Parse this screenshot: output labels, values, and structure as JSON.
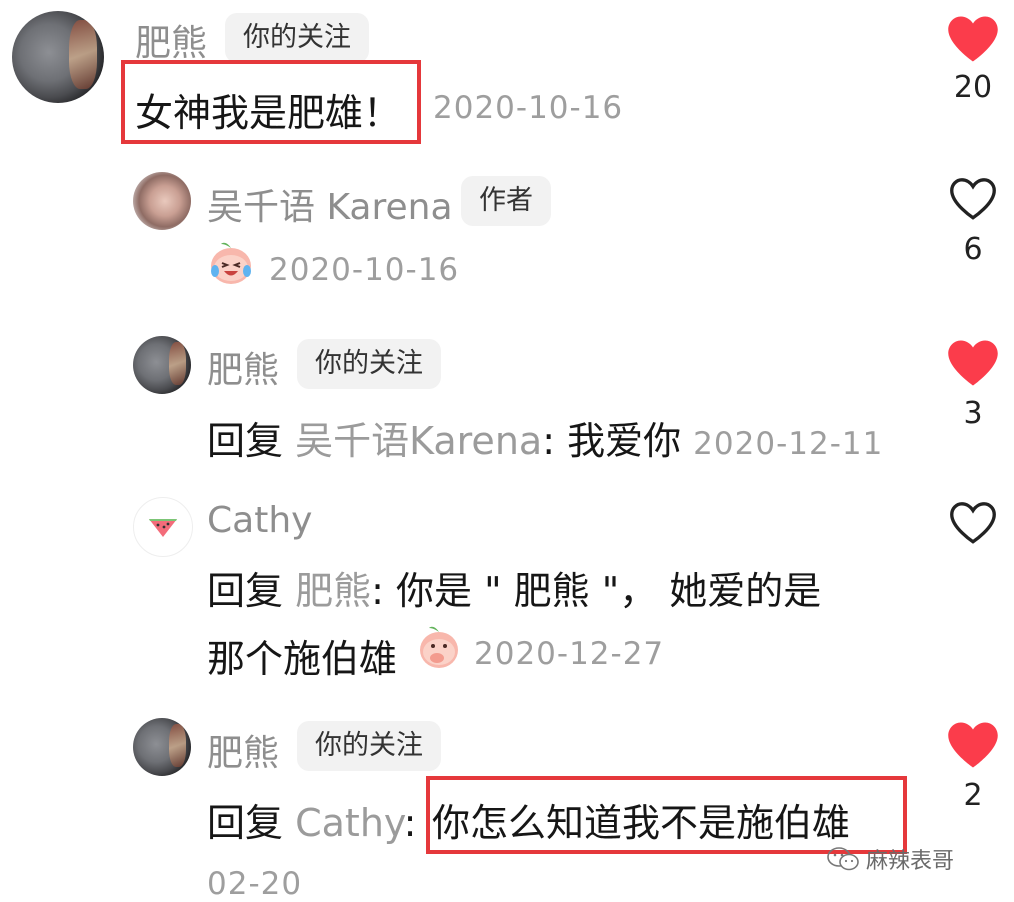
{
  "comments": [
    {
      "user": "肥熊",
      "badge": "你的关注",
      "text": "女神我是肥雄！",
      "date": "2020-10-16",
      "likes": "20",
      "liked": true
    },
    {
      "user": "吴千语 Karena",
      "badge": "作者",
      "emoji": "laughing-peach-emoji",
      "date": "2020-10-16",
      "likes": "6",
      "liked": false
    },
    {
      "user": "肥熊",
      "badge": "你的关注",
      "reply_prefix": "回复",
      "reply_to": "吴千语Karena",
      "text": ": 我爱你",
      "date": "2020-12-11",
      "likes": "3",
      "liked": true
    },
    {
      "user": "Cathy",
      "reply_prefix": "回复",
      "reply_to": "肥熊",
      "text_line1": ": 你是 \" 肥熊 \"， 她爱的是",
      "text_line2": "那个施伯雄",
      "emoji": "covering-mouth-peach-emoji",
      "date": "2020-12-27",
      "liked": false
    },
    {
      "user": "肥熊",
      "badge": "你的关注",
      "reply_prefix": "回复",
      "reply_to": "Cathy",
      "separator": ":",
      "text": "你怎么知道我不是施伯雄",
      "date": "02-20",
      "likes": "2",
      "liked": true
    }
  ],
  "watermark": "麻辣表哥",
  "colors": {
    "heart": "#fb3c4b",
    "highlight": "#e5383b",
    "muted": "#9b9b9b"
  }
}
